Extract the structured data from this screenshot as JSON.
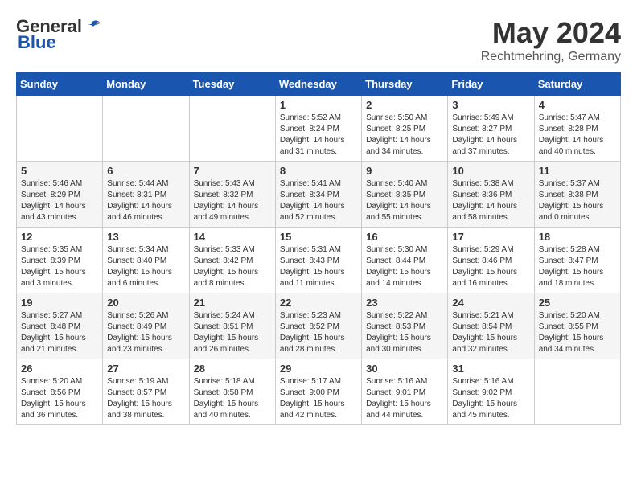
{
  "header": {
    "logo_general": "General",
    "logo_blue": "Blue",
    "month_title": "May 2024",
    "subtitle": "Rechtmehring, Germany"
  },
  "days_of_week": [
    "Sunday",
    "Monday",
    "Tuesday",
    "Wednesday",
    "Thursday",
    "Friday",
    "Saturday"
  ],
  "weeks": [
    [
      {
        "day": "",
        "info": ""
      },
      {
        "day": "",
        "info": ""
      },
      {
        "day": "",
        "info": ""
      },
      {
        "day": "1",
        "info": "Sunrise: 5:52 AM\nSunset: 8:24 PM\nDaylight: 14 hours and 31 minutes."
      },
      {
        "day": "2",
        "info": "Sunrise: 5:50 AM\nSunset: 8:25 PM\nDaylight: 14 hours and 34 minutes."
      },
      {
        "day": "3",
        "info": "Sunrise: 5:49 AM\nSunset: 8:27 PM\nDaylight: 14 hours and 37 minutes."
      },
      {
        "day": "4",
        "info": "Sunrise: 5:47 AM\nSunset: 8:28 PM\nDaylight: 14 hours and 40 minutes."
      }
    ],
    [
      {
        "day": "5",
        "info": "Sunrise: 5:46 AM\nSunset: 8:29 PM\nDaylight: 14 hours and 43 minutes."
      },
      {
        "day": "6",
        "info": "Sunrise: 5:44 AM\nSunset: 8:31 PM\nDaylight: 14 hours and 46 minutes."
      },
      {
        "day": "7",
        "info": "Sunrise: 5:43 AM\nSunset: 8:32 PM\nDaylight: 14 hours and 49 minutes."
      },
      {
        "day": "8",
        "info": "Sunrise: 5:41 AM\nSunset: 8:34 PM\nDaylight: 14 hours and 52 minutes."
      },
      {
        "day": "9",
        "info": "Sunrise: 5:40 AM\nSunset: 8:35 PM\nDaylight: 14 hours and 55 minutes."
      },
      {
        "day": "10",
        "info": "Sunrise: 5:38 AM\nSunset: 8:36 PM\nDaylight: 14 hours and 58 minutes."
      },
      {
        "day": "11",
        "info": "Sunrise: 5:37 AM\nSunset: 8:38 PM\nDaylight: 15 hours and 0 minutes."
      }
    ],
    [
      {
        "day": "12",
        "info": "Sunrise: 5:35 AM\nSunset: 8:39 PM\nDaylight: 15 hours and 3 minutes."
      },
      {
        "day": "13",
        "info": "Sunrise: 5:34 AM\nSunset: 8:40 PM\nDaylight: 15 hours and 6 minutes."
      },
      {
        "day": "14",
        "info": "Sunrise: 5:33 AM\nSunset: 8:42 PM\nDaylight: 15 hours and 8 minutes."
      },
      {
        "day": "15",
        "info": "Sunrise: 5:31 AM\nSunset: 8:43 PM\nDaylight: 15 hours and 11 minutes."
      },
      {
        "day": "16",
        "info": "Sunrise: 5:30 AM\nSunset: 8:44 PM\nDaylight: 15 hours and 14 minutes."
      },
      {
        "day": "17",
        "info": "Sunrise: 5:29 AM\nSunset: 8:46 PM\nDaylight: 15 hours and 16 minutes."
      },
      {
        "day": "18",
        "info": "Sunrise: 5:28 AM\nSunset: 8:47 PM\nDaylight: 15 hours and 18 minutes."
      }
    ],
    [
      {
        "day": "19",
        "info": "Sunrise: 5:27 AM\nSunset: 8:48 PM\nDaylight: 15 hours and 21 minutes."
      },
      {
        "day": "20",
        "info": "Sunrise: 5:26 AM\nSunset: 8:49 PM\nDaylight: 15 hours and 23 minutes."
      },
      {
        "day": "21",
        "info": "Sunrise: 5:24 AM\nSunset: 8:51 PM\nDaylight: 15 hours and 26 minutes."
      },
      {
        "day": "22",
        "info": "Sunrise: 5:23 AM\nSunset: 8:52 PM\nDaylight: 15 hours and 28 minutes."
      },
      {
        "day": "23",
        "info": "Sunrise: 5:22 AM\nSunset: 8:53 PM\nDaylight: 15 hours and 30 minutes."
      },
      {
        "day": "24",
        "info": "Sunrise: 5:21 AM\nSunset: 8:54 PM\nDaylight: 15 hours and 32 minutes."
      },
      {
        "day": "25",
        "info": "Sunrise: 5:20 AM\nSunset: 8:55 PM\nDaylight: 15 hours and 34 minutes."
      }
    ],
    [
      {
        "day": "26",
        "info": "Sunrise: 5:20 AM\nSunset: 8:56 PM\nDaylight: 15 hours and 36 minutes."
      },
      {
        "day": "27",
        "info": "Sunrise: 5:19 AM\nSunset: 8:57 PM\nDaylight: 15 hours and 38 minutes."
      },
      {
        "day": "28",
        "info": "Sunrise: 5:18 AM\nSunset: 8:58 PM\nDaylight: 15 hours and 40 minutes."
      },
      {
        "day": "29",
        "info": "Sunrise: 5:17 AM\nSunset: 9:00 PM\nDaylight: 15 hours and 42 minutes."
      },
      {
        "day": "30",
        "info": "Sunrise: 5:16 AM\nSunset: 9:01 PM\nDaylight: 15 hours and 44 minutes."
      },
      {
        "day": "31",
        "info": "Sunrise: 5:16 AM\nSunset: 9:02 PM\nDaylight: 15 hours and 45 minutes."
      },
      {
        "day": "",
        "info": ""
      }
    ]
  ]
}
